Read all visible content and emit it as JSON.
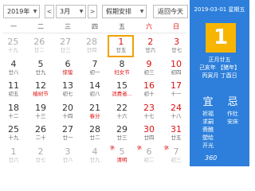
{
  "toolbar": {
    "year": "2019年",
    "prev": "<",
    "month": "3月",
    "next": ">",
    "holiday": "假期安排",
    "back": "返回今天"
  },
  "weekdays": [
    "一",
    "二",
    "三",
    "四",
    "五",
    "六",
    "日"
  ],
  "rows": [
    [
      {
        "day": "25",
        "lunar": "十九",
        "dim": true
      },
      {
        "day": "26",
        "lunar": "廿二",
        "dim": true
      },
      {
        "day": "27",
        "lunar": "廿三",
        "dim": true
      },
      {
        "day": "28",
        "lunar": "廿四",
        "dim": true
      },
      {
        "day": "1",
        "lunar": "廿五",
        "today": true
      },
      {
        "day": "2",
        "lunar": "廿六",
        "we": true
      },
      {
        "day": "3",
        "lunar": "廿七",
        "we": true
      }
    ],
    [
      {
        "day": "4",
        "lunar": "廿八"
      },
      {
        "day": "5",
        "lunar": "廿九"
      },
      {
        "day": "6",
        "lunar": "惊蛰",
        "fest": true
      },
      {
        "day": "7",
        "lunar": "初一"
      },
      {
        "day": "8",
        "lunar": "妇女节",
        "fest": true
      },
      {
        "day": "9",
        "lunar": "初三",
        "we": true
      },
      {
        "day": "10",
        "lunar": "初四",
        "we": true
      }
    ],
    [
      {
        "day": "11",
        "lunar": "初五"
      },
      {
        "day": "12",
        "lunar": "植树节",
        "fest": true
      },
      {
        "day": "13",
        "lunar": "初七"
      },
      {
        "day": "14",
        "lunar": "初八"
      },
      {
        "day": "15",
        "lunar": "消费者...",
        "fest": true
      },
      {
        "day": "16",
        "lunar": "初十",
        "we": true
      },
      {
        "day": "17",
        "lunar": "十一",
        "we": true
      }
    ],
    [
      {
        "day": "18",
        "lunar": "十二"
      },
      {
        "day": "19",
        "lunar": "十三"
      },
      {
        "day": "20",
        "lunar": "十四"
      },
      {
        "day": "21",
        "lunar": "春分",
        "fest": true
      },
      {
        "day": "22",
        "lunar": "十六"
      },
      {
        "day": "23",
        "lunar": "十七",
        "we": true
      },
      {
        "day": "24",
        "lunar": "十八",
        "we": true
      }
    ],
    [
      {
        "day": "25",
        "lunar": "十九"
      },
      {
        "day": "26",
        "lunar": "二十"
      },
      {
        "day": "27",
        "lunar": "廿一"
      },
      {
        "day": "28",
        "lunar": "廿二"
      },
      {
        "day": "29",
        "lunar": "廿三"
      },
      {
        "day": "30",
        "lunar": "廿四",
        "we": true
      },
      {
        "day": "31",
        "lunar": "廿五",
        "we": true
      }
    ],
    [
      {
        "day": "1",
        "lunar": "廿六",
        "dim": true
      },
      {
        "day": "2",
        "lunar": "廿七",
        "dim": true
      },
      {
        "day": "3",
        "lunar": "廿八",
        "dim": true
      },
      {
        "day": "4",
        "lunar": "廿九",
        "dim": true
      },
      {
        "day": "5",
        "lunar": "清明",
        "dim": true,
        "fest": true,
        "badge": "休"
      },
      {
        "day": "6",
        "lunar": "初二",
        "dim": true,
        "badge": "休"
      },
      {
        "day": "7",
        "lunar": "初三",
        "dim": true,
        "badge": "休"
      }
    ]
  ],
  "panel": {
    "date": "2019-03-01 星期五",
    "day": "1",
    "lunar_date": "正月廿五",
    "year_gz": "己亥年 【猪年】",
    "month_day_gz": "丙寅月 丁酉日",
    "yi": "宜",
    "ji": "忌",
    "yi_items": [
      "祈福",
      "求嗣",
      "斋醮",
      "塑绘",
      "开光"
    ],
    "ji_items": [
      "作灶",
      "安床"
    ]
  },
  "watermark": "360"
}
